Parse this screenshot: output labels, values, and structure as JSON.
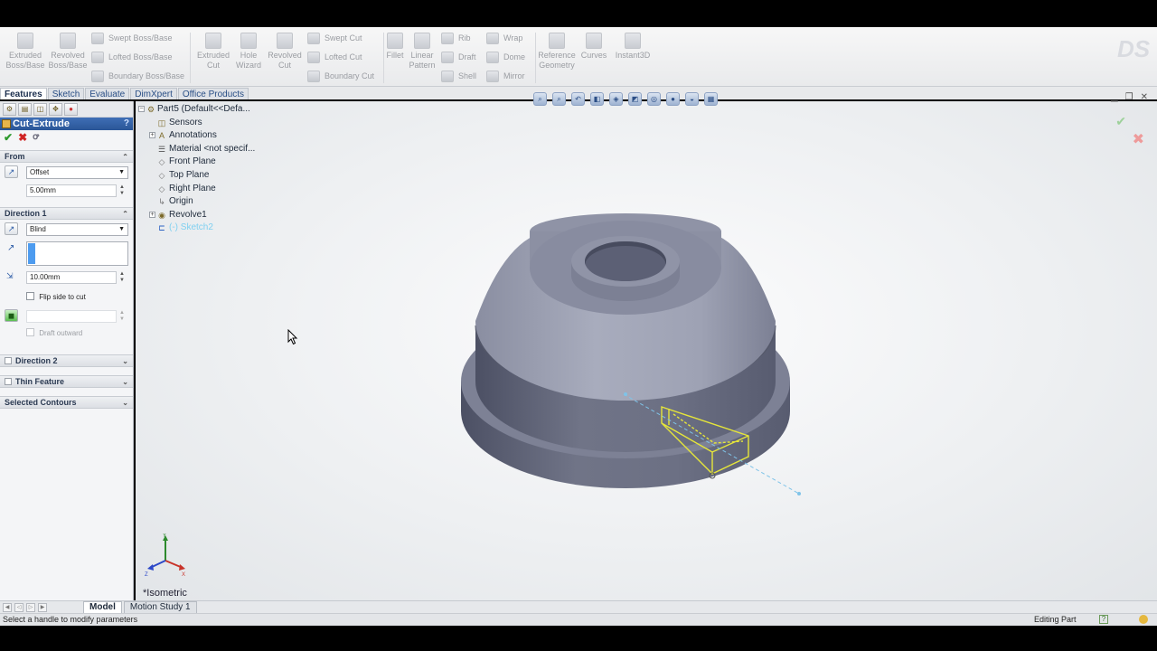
{
  "ribbon": {
    "big_buttons": [
      {
        "label": "Extruded\nBoss/Base",
        "icon": "extruded-boss-icon"
      },
      {
        "label": "Revolved\nBoss/Base",
        "icon": "revolved-boss-icon"
      },
      {
        "label": "Extruded\nCut",
        "icon": "extruded-cut-icon"
      },
      {
        "label": "Hole\nWizard",
        "icon": "hole-wizard-icon"
      },
      {
        "label": "Revolved\nCut",
        "icon": "revolved-cut-icon"
      },
      {
        "label": "Fillet",
        "icon": "fillet-icon"
      },
      {
        "label": "Linear\nPattern",
        "icon": "linear-pattern-icon"
      },
      {
        "label": "Reference\nGeometry",
        "icon": "reference-geometry-icon"
      },
      {
        "label": "Curves",
        "icon": "curves-icon"
      },
      {
        "label": "Instant3D",
        "icon": "instant3d-icon"
      }
    ],
    "small_buttons": [
      {
        "label": "Swept Boss/Base"
      },
      {
        "label": "Lofted Boss/Base"
      },
      {
        "label": "Boundary Boss/Base"
      },
      {
        "label": "Swept Cut"
      },
      {
        "label": "Lofted Cut"
      },
      {
        "label": "Boundary Cut"
      },
      {
        "label": "Rib"
      },
      {
        "label": "Draft"
      },
      {
        "label": "Shell"
      },
      {
        "label": "Wrap"
      },
      {
        "label": "Dome"
      },
      {
        "label": "Mirror"
      }
    ]
  },
  "tabs": [
    "Features",
    "Sketch",
    "Evaluate",
    "DimXpert",
    "Office Products"
  ],
  "property_manager": {
    "title": "Cut-Extrude",
    "help": "?",
    "from": {
      "heading": "From",
      "start_condition": "Offset",
      "offset_value": "5.00mm"
    },
    "direction1": {
      "heading": "Direction 1",
      "end_condition": "Blind",
      "depth": "10.00mm",
      "flip_side_label": "Flip side to cut",
      "draft_outward_label": "Draft outward"
    },
    "collapsed_groups": [
      "Direction 2",
      "Thin Feature",
      "Selected Contours"
    ]
  },
  "feature_tree": {
    "root": "Part5  (Default<<Defa...",
    "items": [
      {
        "label": "Sensors",
        "icon": "sensors-icon",
        "expandable": false
      },
      {
        "label": "Annotations",
        "icon": "annotations-icon",
        "expandable": true
      },
      {
        "label": "Material <not specif...",
        "icon": "material-icon",
        "expandable": false
      },
      {
        "label": "Front Plane",
        "icon": "plane-icon",
        "expandable": false
      },
      {
        "label": "Top Plane",
        "icon": "plane-icon",
        "expandable": false
      },
      {
        "label": "Right Plane",
        "icon": "plane-icon",
        "expandable": false
      },
      {
        "label": "Origin",
        "icon": "origin-icon",
        "expandable": false
      },
      {
        "label": "Revolve1",
        "icon": "revolve-icon",
        "expandable": true
      },
      {
        "label": "(-) Sketch2",
        "icon": "sketch-icon",
        "expandable": false
      }
    ]
  },
  "viewport": {
    "view_name": "*Isometric"
  },
  "bottom_tabs": [
    "Model",
    "Motion Study 1"
  ],
  "status": {
    "message": "Select a handle to modify parameters",
    "mode": "Editing Part",
    "help": "?"
  },
  "colors": {
    "title_bar": "#2a5597",
    "part_body": "#6b6e82",
    "sketch_preview": "#e8e83a",
    "selection": "#4d9bef"
  }
}
